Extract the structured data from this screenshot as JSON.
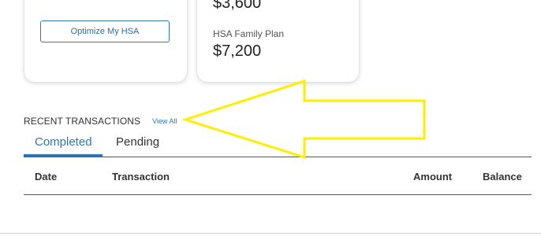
{
  "cards": {
    "left": {
      "button_label": "Optimize My HSA"
    },
    "right": {
      "top_amount": "$3,600",
      "plan_label": "HSA Family Plan",
      "plan_amount": "$7,200"
    }
  },
  "transactions": {
    "heading": "RECENT TRANSACTIONS",
    "view_all_label": "View All",
    "tabs": [
      {
        "label": "Completed",
        "active": true
      },
      {
        "label": "Pending",
        "active": false
      }
    ],
    "columns": [
      "Date",
      "Transaction",
      "Amount",
      "Balance"
    ]
  },
  "colors": {
    "accent": "#2f78b5",
    "annotation_arrow": "#ffee00"
  }
}
